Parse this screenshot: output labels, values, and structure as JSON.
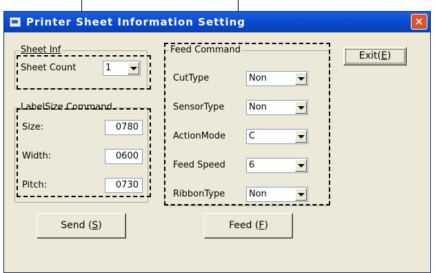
{
  "window": {
    "title": "Printer Sheet Information Setting",
    "close": "✕"
  },
  "sheet_info": {
    "legend": "Sheet Inf",
    "count_label": "Sheet Count",
    "count_value": "1"
  },
  "label_size": {
    "legend": "LabelSize Command",
    "size_label": "Size:",
    "size_value": "0780",
    "width_label": "Width:",
    "width_value": "0600",
    "pitch_label": "Pitch:",
    "pitch_value": "0730"
  },
  "feed_command": {
    "legend": "Feed Command",
    "cut_label": "CutType",
    "cut_value": "Non",
    "sensor_label": "SensorType",
    "sensor_value": "Non",
    "action_label": "ActionMode",
    "action_value": "C",
    "speed_label": "Feed Speed",
    "speed_value": "6",
    "ribbon_label": "RibbonType",
    "ribbon_value": "Non"
  },
  "buttons": {
    "exit_text": "Exit(",
    "exit_key": "E",
    "exit_end": ")",
    "send_text": "Send (",
    "send_key": "S",
    "send_end": ")",
    "feed_text": "Feed (",
    "feed_key": "F",
    "feed_end": ")"
  }
}
